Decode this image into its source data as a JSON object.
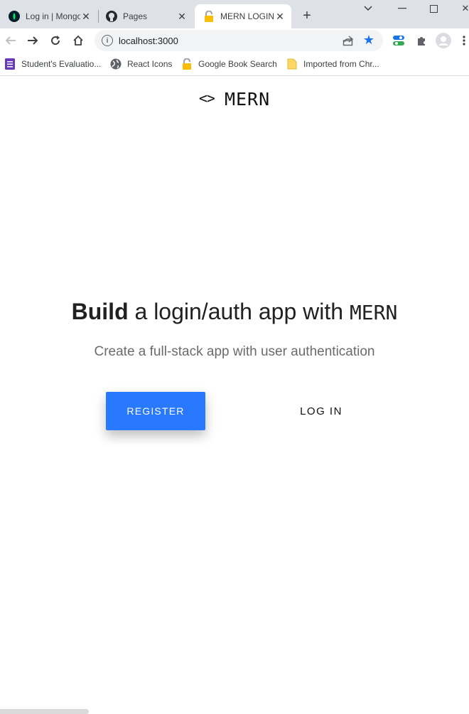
{
  "browser": {
    "tabs": [
      {
        "title": "Log in | MongoDB",
        "icon": "mongodb-leaf-icon"
      },
      {
        "title": "Pages",
        "icon": "github-icon"
      },
      {
        "title": "MERN LOGIN",
        "icon": "lock-icon",
        "active": true
      }
    ],
    "url": "localhost:3000",
    "bookmarks": [
      {
        "label": "Student's Evaluatio...",
        "icon": "forms-icon"
      },
      {
        "label": "React Icons",
        "icon": "globe-icon"
      },
      {
        "label": "Google Book Search",
        "icon": "lock-icon"
      },
      {
        "label": "Imported from Chr...",
        "icon": "folder-icon"
      }
    ]
  },
  "page": {
    "brand_icon": "<>",
    "brand": "MERN",
    "headline_bold": "Build",
    "headline_rest": "a login/auth app with",
    "headline_mono": "MERN",
    "subline": "Create a full-stack app with user authentication",
    "register_label": "REGISTER",
    "login_label": "LOG IN"
  },
  "colors": {
    "accent": "#2979ff",
    "star": "#1a73e8"
  }
}
